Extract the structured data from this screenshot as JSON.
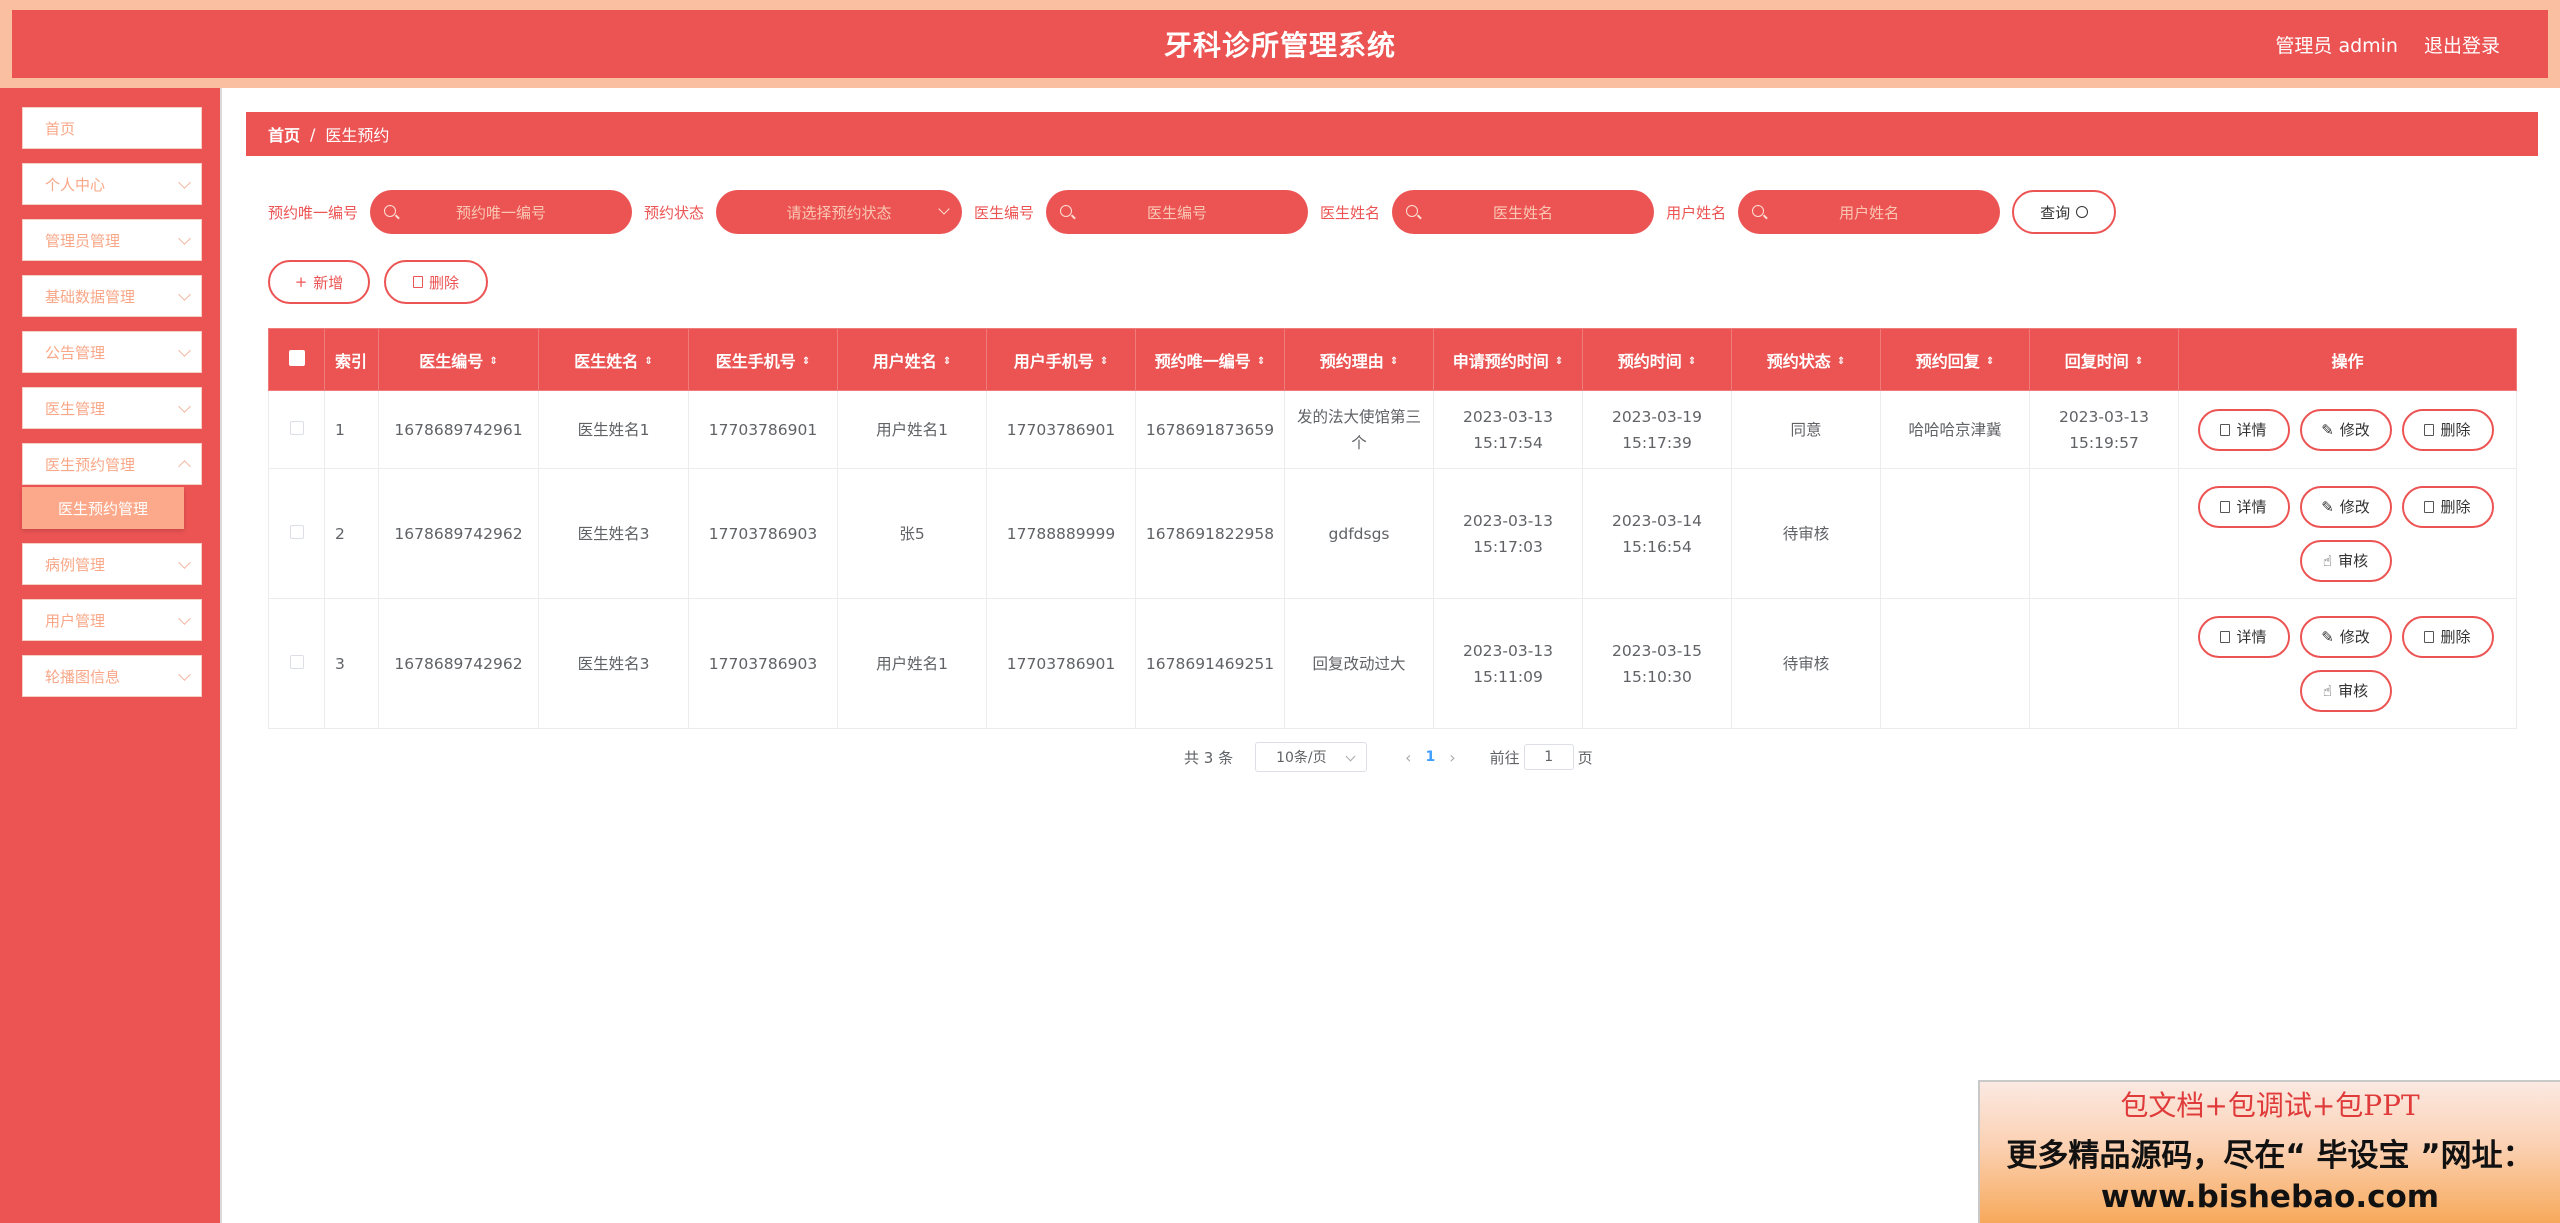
{
  "header": {
    "title": "牙科诊所管理系统",
    "user_label": "管理员 admin",
    "logout_label": "退出登录"
  },
  "sidebar": {
    "items": [
      {
        "label": "首页"
      },
      {
        "label": "个人中心"
      },
      {
        "label": "管理员管理"
      },
      {
        "label": "基础数据管理"
      },
      {
        "label": "公告管理"
      },
      {
        "label": "医生管理"
      },
      {
        "label": "医生预约管理"
      },
      {
        "label": "病例管理"
      },
      {
        "label": "用户管理"
      },
      {
        "label": "轮播图信息"
      }
    ],
    "active_sub": "医生预约管理"
  },
  "breadcrumb": {
    "home": "首页",
    "sep": "/",
    "current": "医生预约"
  },
  "search": {
    "fields": [
      {
        "label": "预约唯一编号",
        "placeholder": "预约唯一编号"
      },
      {
        "label": "预约状态",
        "placeholder": "请选择预约状态"
      },
      {
        "label": "医生编号",
        "placeholder": "医生编号"
      },
      {
        "label": "医生姓名",
        "placeholder": "医生姓名"
      },
      {
        "label": "用户姓名",
        "placeholder": "用户姓名"
      }
    ],
    "query_label": "查询"
  },
  "actions": {
    "add_label": "新增",
    "delete_label": "删除"
  },
  "table": {
    "columns": [
      "索引",
      "医生编号",
      "医生姓名",
      "医生手机号",
      "用户姓名",
      "用户手机号",
      "预约唯一编号",
      "预约理由",
      "申请预约时间",
      "预约时间",
      "预约状态",
      "预约回复",
      "回复时间",
      "操作"
    ],
    "rows": [
      {
        "index": "1",
        "doctor_no": "1678689742961",
        "doctor_name": "医生姓名1",
        "doctor_phone": "17703786901",
        "user_name": "用户姓名1",
        "user_phone": "17703786901",
        "appt_no": "1678691873659",
        "reason": "发的法大使馆第三个",
        "apply_time": "2023-03-13 15:17:54",
        "appt_time": "2023-03-19 15:17:39",
        "status": "同意",
        "reply": "哈哈哈京津冀",
        "reply_time": "2023-03-13 15:19:57"
      },
      {
        "index": "2",
        "doctor_no": "1678689742962",
        "doctor_name": "医生姓名3",
        "doctor_phone": "17703786903",
        "user_name": "张5",
        "user_phone": "17788889999",
        "appt_no": "1678691822958",
        "reason": "gdfdsgs",
        "apply_time": "2023-03-13 15:17:03",
        "appt_time": "2023-03-14 15:16:54",
        "status": "待审核",
        "reply": "",
        "reply_time": ""
      },
      {
        "index": "3",
        "doctor_no": "1678689742962",
        "doctor_name": "医生姓名3",
        "doctor_phone": "17703786903",
        "user_name": "用户姓名1",
        "user_phone": "17703786901",
        "appt_no": "1678691469251",
        "reason": "回复改动过大",
        "apply_time": "2023-03-13 15:11:09",
        "appt_time": "2023-03-15 15:10:30",
        "status": "待审核",
        "reply": "",
        "reply_time": ""
      }
    ],
    "op_labels": {
      "detail": "详情",
      "edit": "修改",
      "delete": "删除",
      "audit": "审核"
    }
  },
  "pagination": {
    "total_text": "共 3 条",
    "page_size": "10条/页",
    "current_page": "1",
    "goto_prefix": "前往",
    "goto_value": "1",
    "goto_suffix": "页"
  },
  "promo": {
    "line1": "包文档+包调试+包PPT",
    "line2": "更多精品源码，尽在“ 毕设宝 ”网址：",
    "line3": "www.bishebao.com"
  },
  "colors": {
    "primary": "#ec5454",
    "accent": "#f9a787",
    "header_frame": "#f9bfa0"
  }
}
